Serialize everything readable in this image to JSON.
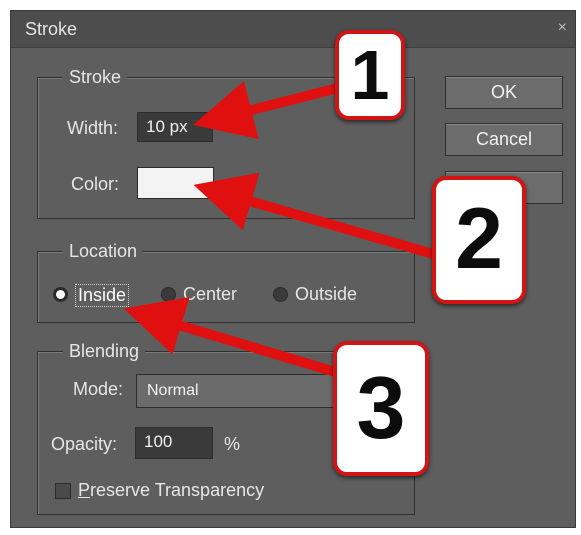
{
  "dialog": {
    "title": "Stroke",
    "close_glyph": "×"
  },
  "stroke_group": {
    "legend": "Stroke",
    "width_label": "Width:",
    "width_value": "10 px",
    "color_label": "Color:",
    "color_value": "#f3f3f3"
  },
  "location_group": {
    "legend": "Location",
    "options": [
      {
        "label": "Inside",
        "selected": true
      },
      {
        "label": "Center",
        "selected": false
      },
      {
        "label": "Outside",
        "selected": false
      }
    ]
  },
  "blending_group": {
    "legend": "Blending",
    "mode_label": "Mode:",
    "mode_value": "Normal",
    "opacity_label": "Opacity:",
    "opacity_value": "100",
    "opacity_unit": "%",
    "preserve_label": "Preserve Transparency",
    "preserve_checked": false
  },
  "buttons": {
    "ok": "OK",
    "cancel": "Cancel"
  },
  "annotations": [
    {
      "number": "1"
    },
    {
      "number": "2"
    },
    {
      "number": "3"
    }
  ],
  "colors": {
    "arrow": "#e01010",
    "badge_border": "#d11414",
    "dialog_bg": "#5e5e5e"
  },
  "icons": {
    "close": "close-icon",
    "dropdown": "chevron-down-icon"
  }
}
